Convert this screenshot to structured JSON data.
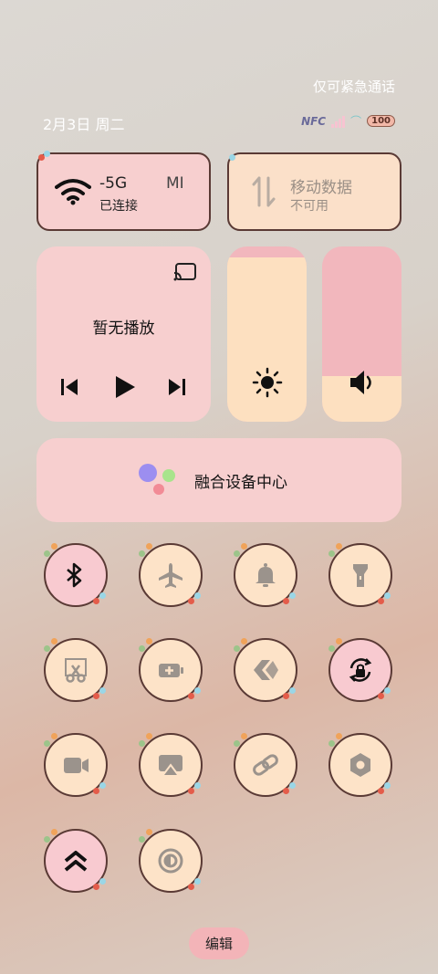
{
  "status": {
    "emergency": "仅可紧急通话",
    "date": "2月3日 周二",
    "nfc": "NFC",
    "battery": "100"
  },
  "wifi": {
    "ssid": "-5G",
    "ssid_suffix": "MI",
    "state": "已连接"
  },
  "mobile": {
    "title": "移动数据",
    "state": "不可用"
  },
  "media": {
    "title": "暂无播放"
  },
  "brightness": {
    "level_percent": 94
  },
  "volume": {
    "level_percent": 26
  },
  "device_center": {
    "label": "融合设备中心"
  },
  "tiles": [
    {
      "icon": "bluetooth-icon",
      "active": true
    },
    {
      "icon": "airplane-icon",
      "active": false
    },
    {
      "icon": "bell-icon",
      "active": false
    },
    {
      "icon": "flashlight-icon",
      "active": false
    },
    {
      "icon": "screenshot-icon",
      "active": false
    },
    {
      "icon": "battery-saver-icon",
      "active": false
    },
    {
      "icon": "nearby-share-icon",
      "active": false
    },
    {
      "icon": "rotation-lock-icon",
      "active": true
    },
    {
      "icon": "screen-record-icon",
      "active": false
    },
    {
      "icon": "cast-screen-icon",
      "active": false
    },
    {
      "icon": "link-icon",
      "active": false
    },
    {
      "icon": "settings-icon",
      "active": false
    },
    {
      "icon": "boost-icon",
      "active": true
    },
    {
      "icon": "contrast-icon",
      "active": false
    }
  ],
  "edit": {
    "label": "编辑"
  },
  "colors": {
    "tile_active": "#f8cad0",
    "tile_inactive": "#fde3c8",
    "panel": "#f7cfcf"
  }
}
